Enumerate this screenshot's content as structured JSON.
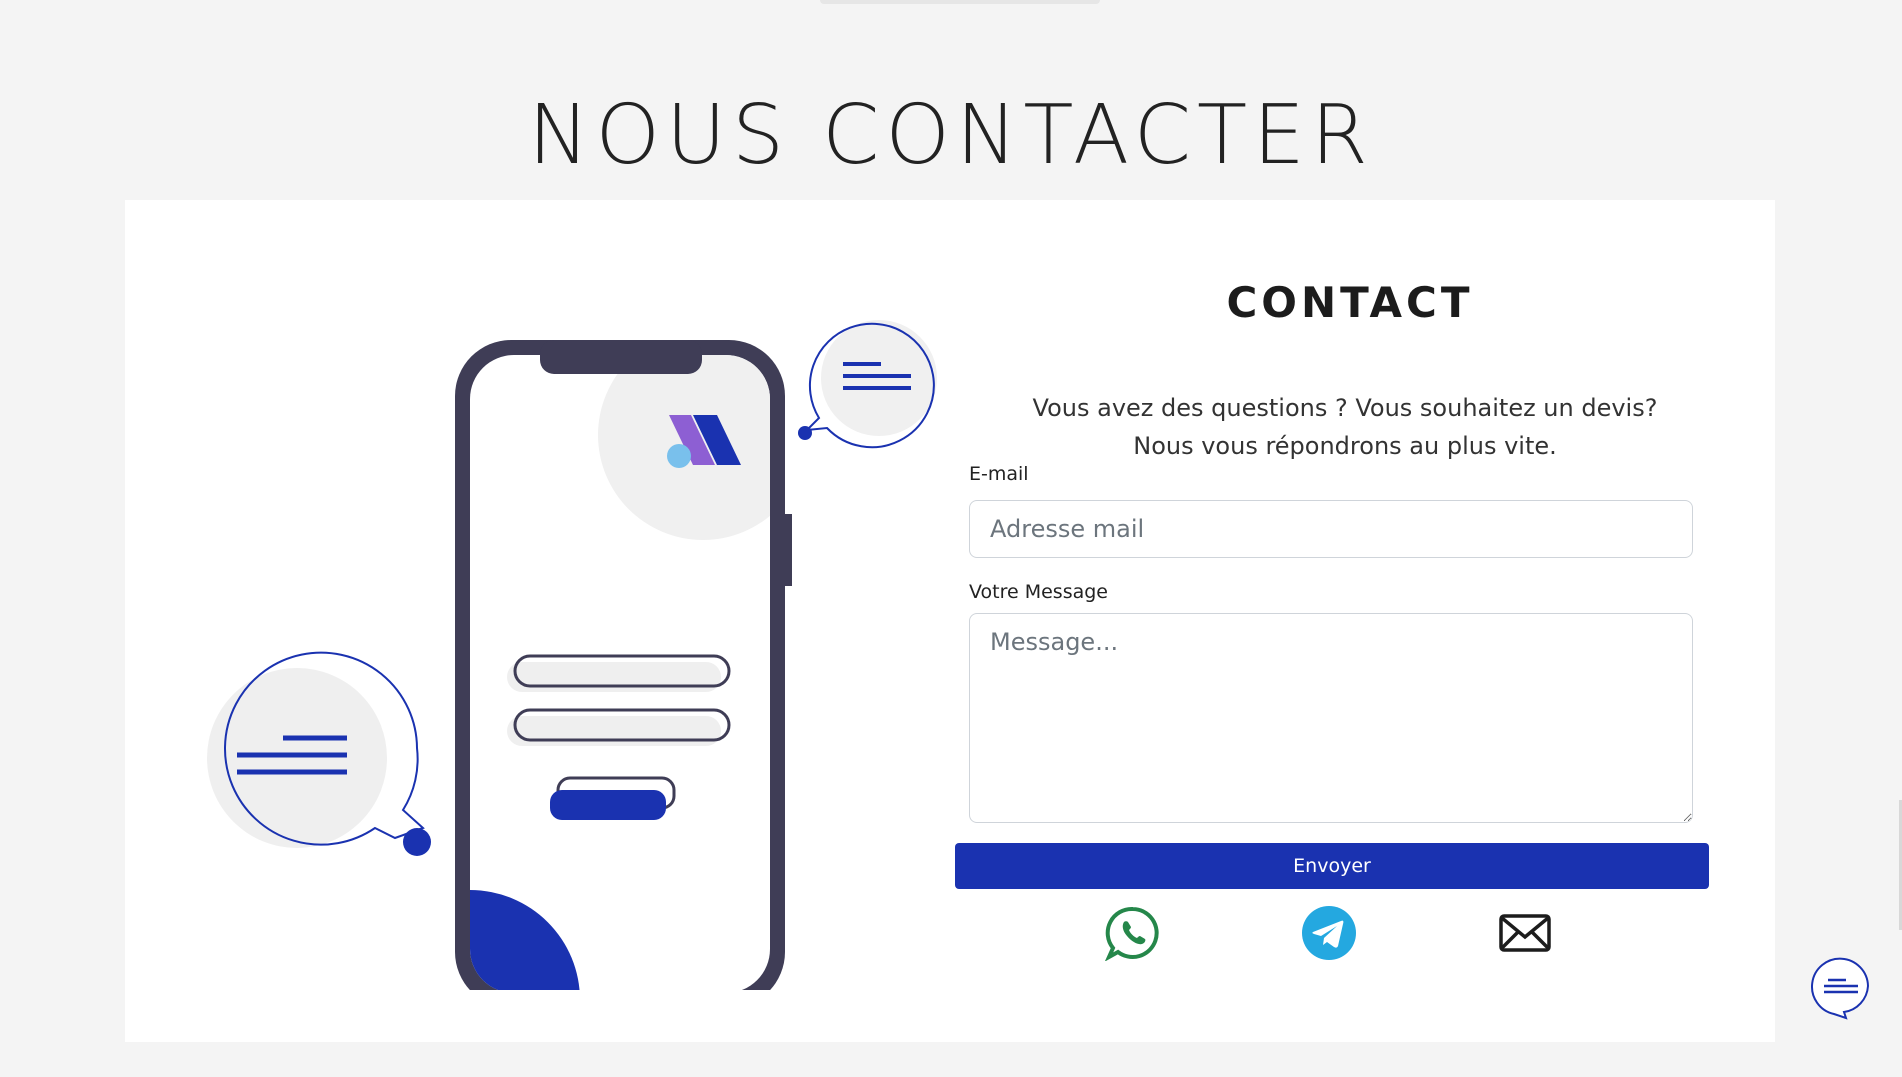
{
  "page": {
    "title": "Nous contacter"
  },
  "form": {
    "title": "Contact",
    "intro": "Vous avez des questions ? Vous souhaitez un devis? Nous vous répondrons au plus vite.",
    "email_label": "E-mail",
    "email_placeholder": "Adresse mail",
    "message_label": "Votre Message",
    "message_placeholder": "Message...",
    "submit_label": "Envoyer"
  },
  "contact_icons": [
    {
      "icon": "whatsapp-icon",
      "color": "#25874a"
    },
    {
      "icon": "telegram-icon",
      "color": "#24a8e0"
    },
    {
      "icon": "email-icon",
      "color": "#1c1c1c"
    }
  ],
  "colors": {
    "accent": "#1a32b0",
    "phone_frame": "#3f3d56",
    "background": "#f4f4f4"
  }
}
